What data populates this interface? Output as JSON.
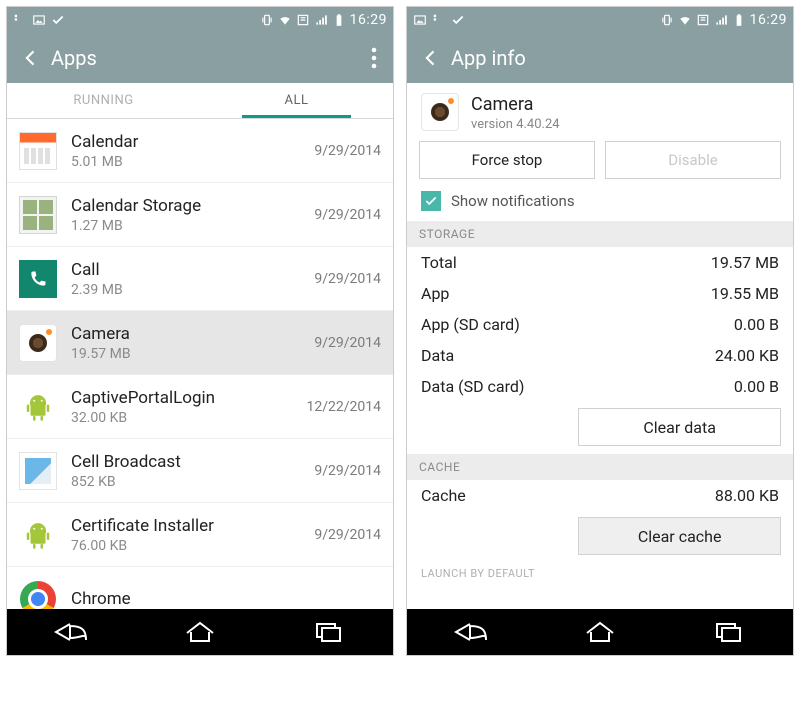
{
  "status": {
    "time": "16:29"
  },
  "left": {
    "title": "Apps",
    "tabs": {
      "running": "RUNNING",
      "all": "ALL"
    },
    "apps": [
      {
        "name": "Calendar",
        "size": "5.01 MB",
        "date": "9/29/2014",
        "icon": "calendar"
      },
      {
        "name": "Calendar Storage",
        "size": "1.27 MB",
        "date": "9/29/2014",
        "icon": "calstorage"
      },
      {
        "name": "Call",
        "size": "2.39 MB",
        "date": "9/29/2014",
        "icon": "call"
      },
      {
        "name": "Camera",
        "size": "19.57 MB",
        "date": "9/29/2014",
        "icon": "camera",
        "selected": true
      },
      {
        "name": "CaptivePortalLogin",
        "size": "32.00 KB",
        "date": "12/22/2014",
        "icon": "android"
      },
      {
        "name": "Cell Broadcast",
        "size": "852 KB",
        "date": "9/29/2014",
        "icon": "cellb"
      },
      {
        "name": "Certificate Installer",
        "size": "76.00 KB",
        "date": "9/29/2014",
        "icon": "android"
      },
      {
        "name": "Chrome",
        "size": "",
        "date": "",
        "icon": "chrome"
      }
    ]
  },
  "right": {
    "title": "App info",
    "app": {
      "name": "Camera",
      "version": "version 4.40.24",
      "icon": "camera"
    },
    "buttons": {
      "force_stop": "Force stop",
      "disable": "Disable"
    },
    "show_notifications_label": "Show notifications",
    "sections": {
      "storage_header": "STORAGE",
      "storage": [
        {
          "k": "Total",
          "v": "19.57 MB"
        },
        {
          "k": "App",
          "v": "19.55 MB"
        },
        {
          "k": "App (SD card)",
          "v": "0.00 B"
        },
        {
          "k": "Data",
          "v": "24.00 KB"
        },
        {
          "k": "Data (SD card)",
          "v": "0.00 B"
        }
      ],
      "clear_data": "Clear data",
      "cache_header": "CACHE",
      "cache": {
        "k": "Cache",
        "v": "88.00 KB"
      },
      "clear_cache": "Clear cache",
      "launch_header": "LAUNCH BY DEFAULT"
    }
  }
}
